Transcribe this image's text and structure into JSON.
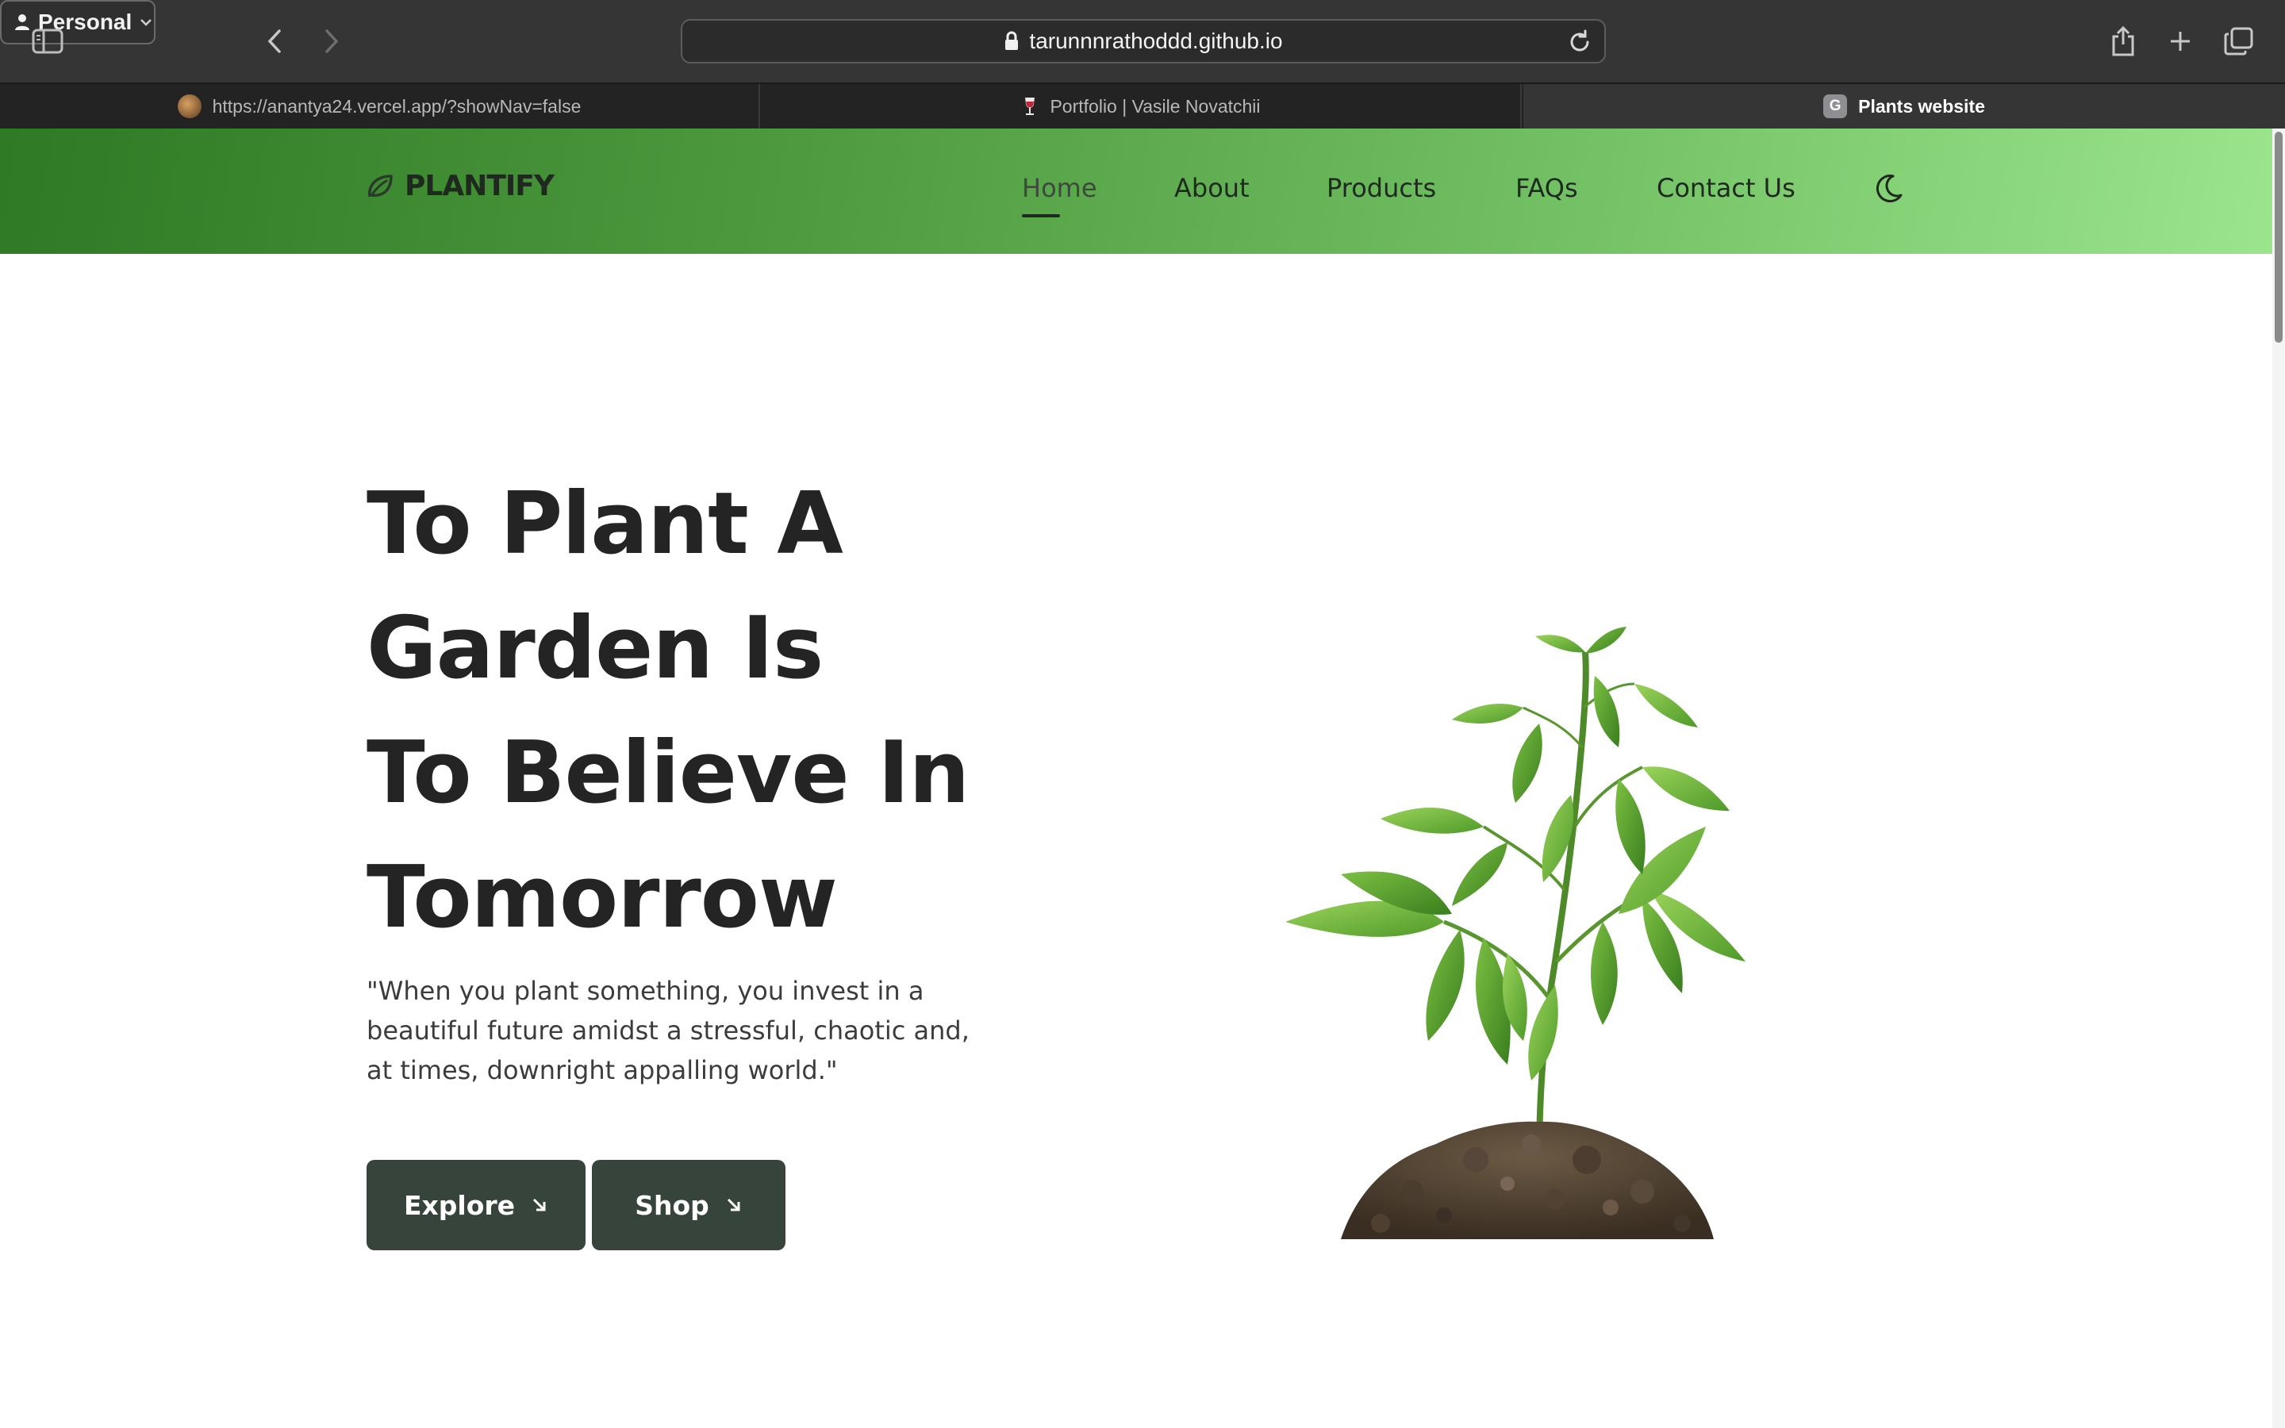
{
  "browser": {
    "profile_label": "Personal",
    "address": "tarunnnrathoddd.github.io",
    "tabs": [
      {
        "label": "https://anantya24.vercel.app/?showNav=false",
        "icon": "photo-favicon-icon",
        "active": false
      },
      {
        "label": "Portfolio | Vasile Novatchii",
        "icon": "wine-favicon-icon",
        "active": false
      },
      {
        "label": "Plants website",
        "icon": "g-favicon-icon",
        "favicon_letter": "G",
        "active": true
      }
    ],
    "icons": {
      "sidebar": "sidebar-icon",
      "profile": "person-icon",
      "back": "chevron-left-icon",
      "forward": "chevron-right-icon",
      "lock": "lock-icon",
      "reload": "reload-icon",
      "share": "share-icon",
      "new_tab": "plus-icon",
      "tab_overview": "tabs-overview-icon"
    }
  },
  "site": {
    "brand": "PLANTIFY",
    "brand_icon": "leaf-icon",
    "nav": {
      "home": "Home",
      "about": "About",
      "products": "Products",
      "faqs": "FAQs",
      "contact": "Contact Us",
      "active": "Home",
      "theme_icon": "moon-icon"
    },
    "hero": {
      "title_lines": [
        "To Plant A",
        "Garden Is",
        "To Believe In",
        "Tomorrow"
      ],
      "quote": "\"When you plant something, you invest in a beautiful future amidst a stressful, chaotic and, at times, downright appalling world.\"",
      "buttons": {
        "explore": "Explore",
        "shop": "Shop",
        "arrow_icon": "arrow-down-right-icon"
      },
      "image": "plant-sapling-in-soil"
    },
    "colors": {
      "nav_gradient_start": "#2e7a25",
      "nav_gradient_end": "#9be58c",
      "button_bg": "#36443c",
      "title_text": "#242424"
    }
  }
}
